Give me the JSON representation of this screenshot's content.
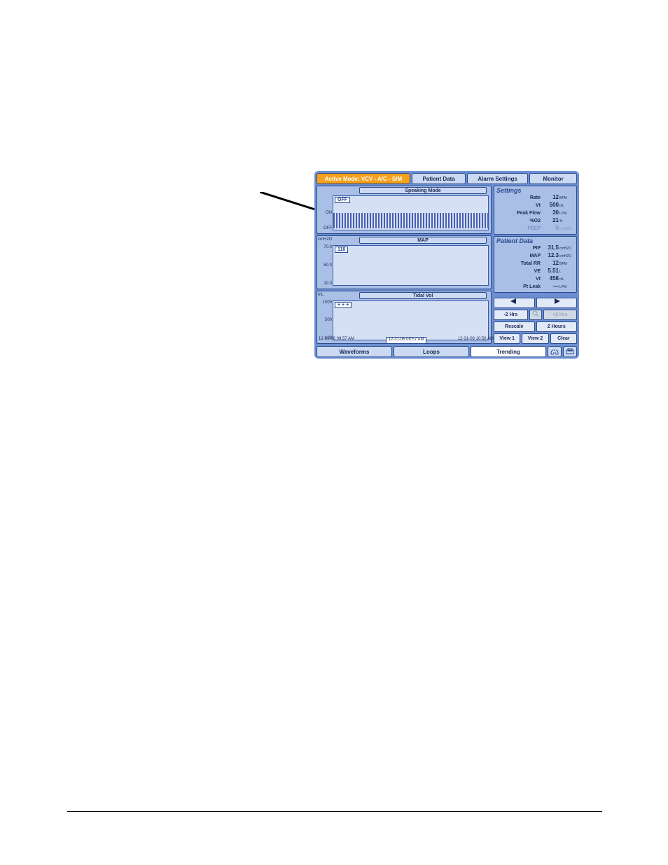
{
  "topTabs": {
    "activeMode": "Active Mode:  VCV - A/C - S/M",
    "patientData": "Patient Data",
    "alarmSettings": "Alarm Settings",
    "monitor": "Monitor"
  },
  "graphs": {
    "speaking": {
      "title": "Speaking Mode",
      "valueBox": "OFF",
      "yTicks": [
        "ON",
        "OFF"
      ],
      "unit": ""
    },
    "map": {
      "title": "MAP",
      "valueBox": "118",
      "unit": "cmH2O",
      "yTicks": [
        "70.0",
        "50.0",
        "10.0"
      ]
    },
    "tidal": {
      "title": "Tidal Vol",
      "valueBox": "+ + +",
      "unit": "mL",
      "yTicks": [
        "1000",
        "500",
        "100"
      ]
    }
  },
  "timestamps": {
    "left": "12-31-06  08:57 AM",
    "mid": "12-31-06  09:57 AM",
    "right": "12-31-06  10:56 AM"
  },
  "settings": {
    "title": "Settings",
    "rows": [
      {
        "label": "Rate",
        "value": "12",
        "unit": "BPM"
      },
      {
        "label": "Vt",
        "value": "500",
        "unit": "mL"
      },
      {
        "label": "Peak Flow",
        "value": "30",
        "unit": "LPM"
      },
      {
        "label": "%O2",
        "value": "21",
        "unit": "%"
      },
      {
        "label": "PEEP",
        "value": "0",
        "unit": "cmH2O",
        "dim": true
      }
    ]
  },
  "patientData": {
    "title": "Patient Data",
    "rows": [
      {
        "label": "PIP",
        "value": "31.5",
        "unit": "cmH2O"
      },
      {
        "label": "MAP",
        "value": "12.3",
        "unit": "cmH2O"
      },
      {
        "label": "Total RR",
        "value": "12",
        "unit": "BPM"
      },
      {
        "label": "VE",
        "value": "5.51",
        "unit": "L"
      },
      {
        "label": "Vt",
        "value": "458",
        "unit": "mL"
      },
      {
        "label": "Pt Leak",
        "value": "---",
        "unit": "LPM"
      }
    ]
  },
  "controls": {
    "minus2h": "-2 Hrs",
    "plus2h": "+2 Hrs",
    "rescale": "Rescale",
    "twoHours": "2 Hours",
    "view1": "View 1",
    "view2": "View 2",
    "clear": "Clear"
  },
  "bottomTabs": {
    "waveforms": "Waveforms",
    "loops": "Loops",
    "trending": "Trending"
  }
}
